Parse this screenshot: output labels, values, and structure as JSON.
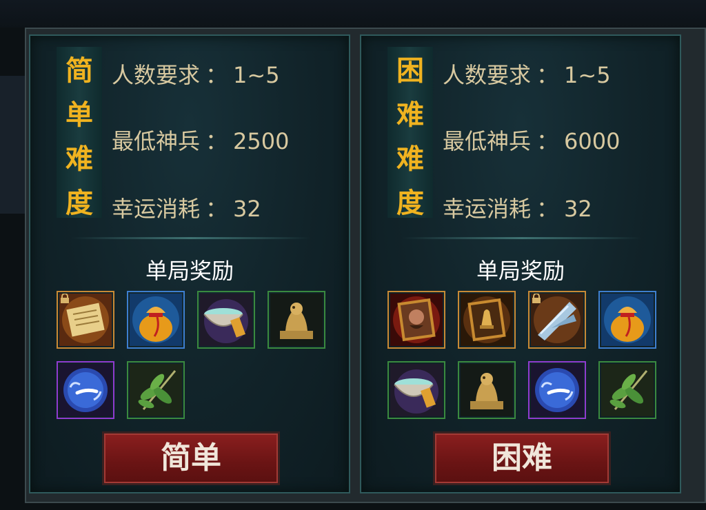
{
  "panels": [
    {
      "id": "easy",
      "title": "简单难度",
      "title_chars": [
        "简",
        "单",
        "难",
        "度"
      ],
      "info": [
        {
          "label": "人数要求",
          "value": "1~5"
        },
        {
          "label": "最低神兵",
          "value": "2500"
        },
        {
          "label": "幸运消耗",
          "value": "32"
        }
      ],
      "colon": "：",
      "reward_title": "单局奖励",
      "items": [
        {
          "name": "scroll-item-icon",
          "rarity": "orange",
          "locked": true
        },
        {
          "name": "lucky-bag-item-icon",
          "rarity": "blue",
          "locked": false
        },
        {
          "name": "bowl-item-icon",
          "rarity": "green",
          "locked": false
        },
        {
          "name": "golden-seal-item-icon",
          "rarity": "green",
          "locked": false
        },
        {
          "name": "spirit-orb-item-icon",
          "rarity": "purple",
          "locked": false
        },
        {
          "name": "herb-leaves-item-icon",
          "rarity": "green",
          "locked": false
        }
      ],
      "button_label": "简单"
    },
    {
      "id": "hard",
      "title": "困难难度",
      "title_chars": [
        "困",
        "难",
        "难",
        "度"
      ],
      "info": [
        {
          "label": "人数要求",
          "value": "1~5"
        },
        {
          "label": "最低神兵",
          "value": "6000"
        },
        {
          "label": "幸运消耗",
          "value": "32"
        }
      ],
      "colon": "：",
      "reward_title": "单局奖励",
      "items": [
        {
          "name": "general-card-item-icon",
          "rarity": "orange",
          "locked": false
        },
        {
          "name": "bell-card-item-icon",
          "rarity": "orange",
          "locked": false
        },
        {
          "name": "ice-shard-item-icon",
          "rarity": "orange",
          "locked": true
        },
        {
          "name": "lucky-bag-item-icon",
          "rarity": "blue",
          "locked": false
        },
        {
          "name": "bowl-item-icon",
          "rarity": "green",
          "locked": false
        },
        {
          "name": "golden-seal-item-icon",
          "rarity": "green",
          "locked": false
        },
        {
          "name": "spirit-orb-item-icon",
          "rarity": "purple",
          "locked": false
        },
        {
          "name": "herb-leaves-item-icon",
          "rarity": "green",
          "locked": false
        }
      ],
      "button_label": "困难"
    }
  ],
  "colors": {
    "title_gold": "#f0b320",
    "info_text": "#d8c9a0",
    "button_red": "#8b1f1f"
  }
}
